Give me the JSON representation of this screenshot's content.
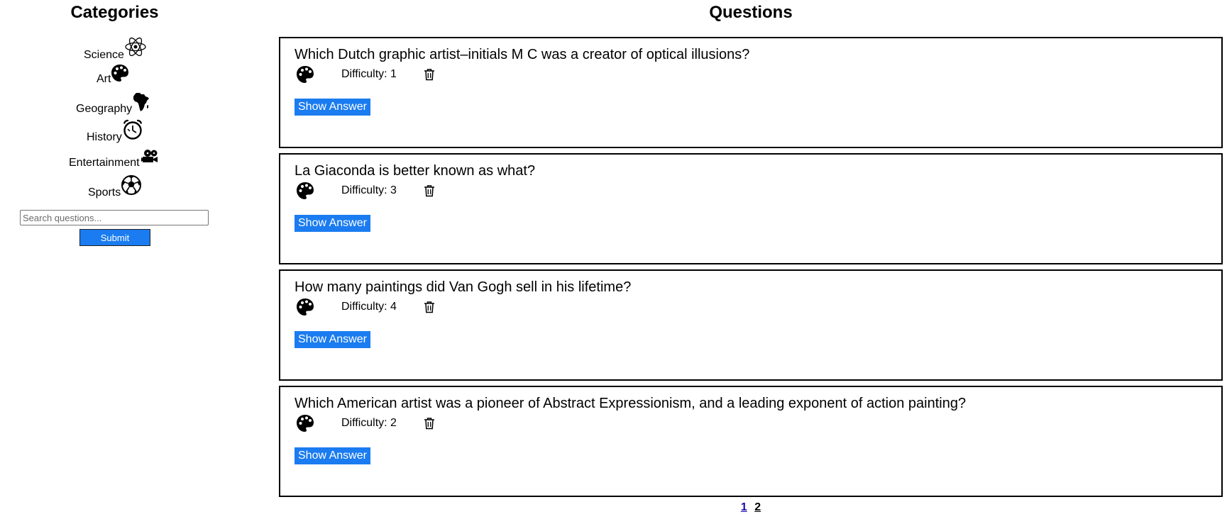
{
  "sidebar": {
    "title": "Categories",
    "categories": [
      {
        "label": "Science",
        "icon": "atom-icon"
      },
      {
        "label": "Art",
        "icon": "palette-icon"
      },
      {
        "label": "Geography",
        "icon": "africa-icon"
      },
      {
        "label": "History",
        "icon": "alarm-clock-icon"
      },
      {
        "label": "Entertainment",
        "icon": "film-camera-icon"
      },
      {
        "label": "Sports",
        "icon": "soccer-ball-icon"
      }
    ],
    "search": {
      "placeholder": "Search questions...",
      "value": ""
    },
    "submit_label": "Submit"
  },
  "main": {
    "title": "Questions",
    "questions": [
      {
        "text": "Which Dutch graphic artist–initials M C was a creator of optical illusions?",
        "difficulty": "Difficulty: 1",
        "category_icon": "palette-icon",
        "action_label": "Show Answer"
      },
      {
        "text": "La Giaconda is better known as what?",
        "difficulty": "Difficulty: 3",
        "category_icon": "palette-icon",
        "action_label": "Show Answer"
      },
      {
        "text": "How many paintings did Van Gogh sell in his lifetime?",
        "difficulty": "Difficulty: 4",
        "category_icon": "palette-icon",
        "action_label": "Show Answer"
      },
      {
        "text": "Which American artist was a pioneer of Abstract Expressionism, and a leading exponent of action painting?",
        "difficulty": "Difficulty: 2",
        "category_icon": "palette-icon",
        "action_label": "Show Answer"
      }
    ],
    "pagination": {
      "pages": [
        "1",
        "2"
      ],
      "current": "1"
    }
  },
  "colors": {
    "accent": "#1a7cf0",
    "link": "#1a0dab"
  }
}
